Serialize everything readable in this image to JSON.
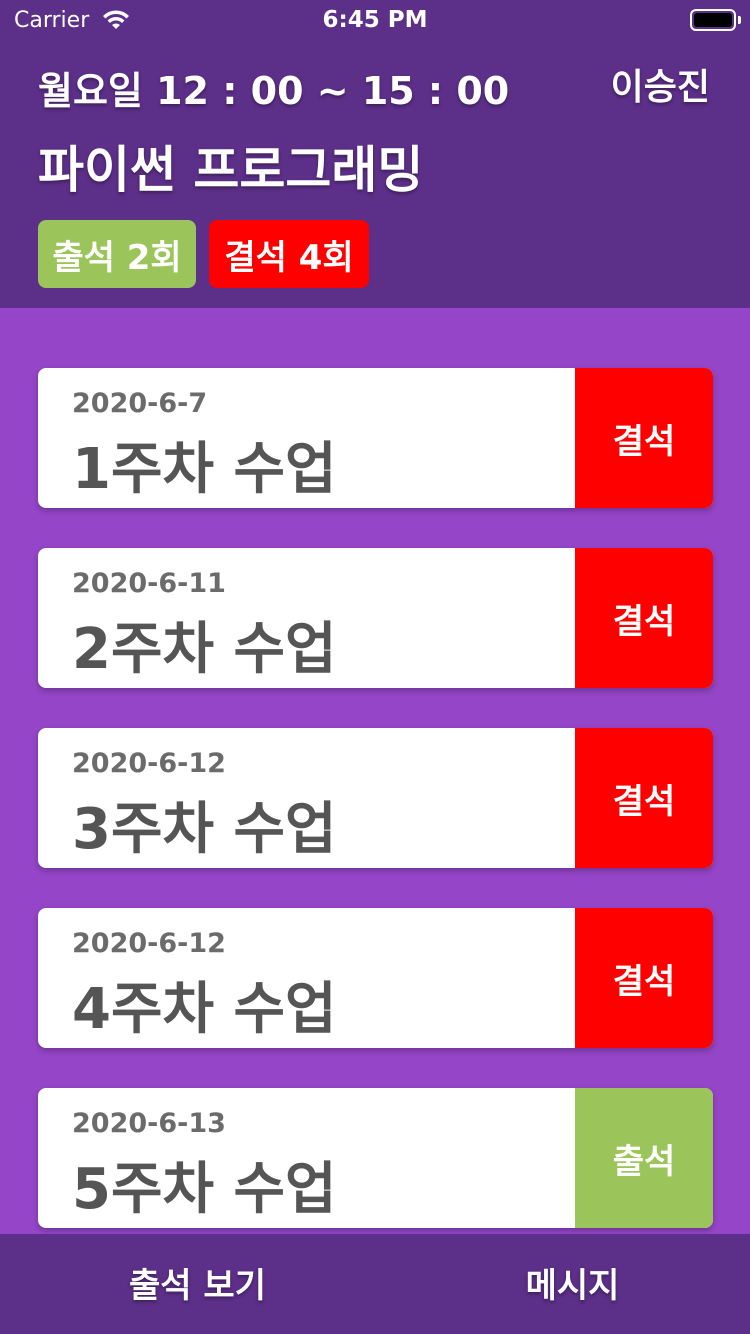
{
  "status_bar": {
    "carrier": "Carrier",
    "time": "6:45 PM"
  },
  "header": {
    "schedule": "월요일 12 : 00 ~ 15 : 00",
    "user": "이승진",
    "course": "파이썬 프로그래밍",
    "present_badge": "출석 2회",
    "absent_badge": "결석 4회"
  },
  "colors": {
    "present": "#9bc45a",
    "absent": "#ff0000"
  },
  "sessions": [
    {
      "date": "2020-6-7",
      "title": "1주차 수업",
      "status": "결석",
      "state": "absent"
    },
    {
      "date": "2020-6-11",
      "title": "2주차 수업",
      "status": "결석",
      "state": "absent"
    },
    {
      "date": "2020-6-12",
      "title": "3주차 수업",
      "status": "결석",
      "state": "absent"
    },
    {
      "date": "2020-6-12",
      "title": "4주차 수업",
      "status": "결석",
      "state": "absent"
    },
    {
      "date": "2020-6-13",
      "title": "5주차 수업",
      "status": "출석",
      "state": "present"
    }
  ],
  "tabbar": {
    "attendance_label": "출석 보기",
    "message_label": "메시지"
  }
}
